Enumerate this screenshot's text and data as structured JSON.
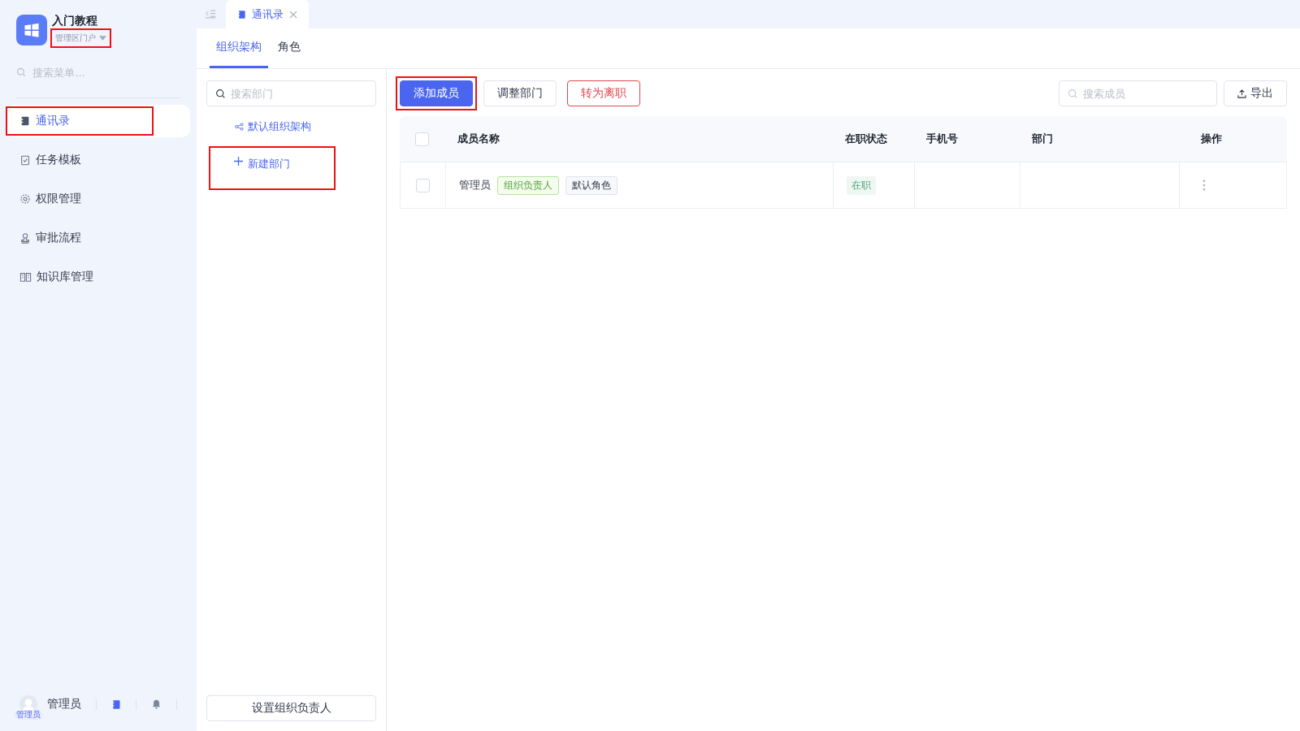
{
  "app": {
    "title": "入门教程",
    "portal": "管理区门户",
    "portal_highlighted": true
  },
  "sidebar": {
    "search_placeholder": "搜索菜单...",
    "items": [
      {
        "label": "通讯录",
        "selected": true,
        "highlighted": true
      },
      {
        "label": "任务模板",
        "selected": false,
        "highlighted": false
      },
      {
        "label": "权限管理",
        "selected": false,
        "highlighted": false
      },
      {
        "label": "审批流程",
        "selected": false,
        "highlighted": false
      },
      {
        "label": "知识库管理",
        "selected": false,
        "highlighted": false
      }
    ],
    "user": {
      "name": "管理员",
      "badge": "管理员"
    }
  },
  "open_tabs": [
    {
      "label": "通讯录",
      "selected": true
    }
  ],
  "subtabs": [
    {
      "label": "组织架构",
      "selected": true
    },
    {
      "label": "角色",
      "selected": false
    }
  ],
  "dept_panel": {
    "search_placeholder": "搜索部门",
    "tree_root": "默认组织架构",
    "new_button": "新建部门",
    "new_highlighted": true,
    "footer_button": "设置组织负责人"
  },
  "toolbar": {
    "buttons": [
      {
        "label": "添加成员",
        "kind": "primary",
        "highlighted": true
      },
      {
        "label": "调整部门",
        "kind": "default",
        "highlighted": false
      },
      {
        "label": "转为离职",
        "kind": "danger",
        "highlighted": false
      }
    ],
    "search_placeholder": "搜索成员",
    "export_button": "导出"
  },
  "table": {
    "all_checked": false,
    "columns": [
      "成员名称",
      "在职状态",
      "手机号",
      "部门",
      "操作"
    ],
    "rows": [
      {
        "checked": false,
        "name": "管理员",
        "tags": [
          {
            "label": "组织负责人",
            "kind": "green"
          },
          {
            "label": "默认角色",
            "kind": "gray"
          }
        ],
        "status": "在职",
        "phone": "",
        "department": ""
      }
    ]
  }
}
